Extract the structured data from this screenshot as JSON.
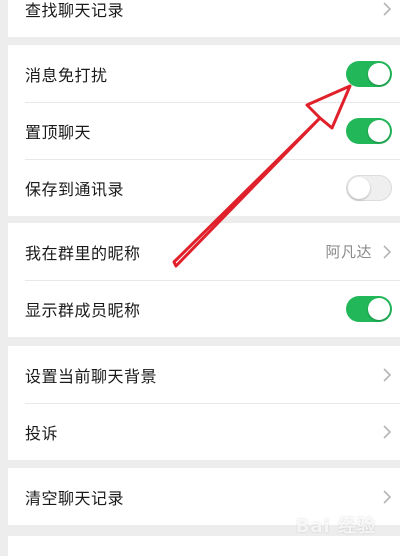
{
  "settings": {
    "search_history": {
      "label": "查找聊天记录"
    },
    "mute": {
      "label": "消息免打扰",
      "enabled": true
    },
    "sticky_on_top": {
      "label": "置顶聊天",
      "enabled": true
    },
    "save_to_contacts": {
      "label": "保存到通讯录",
      "enabled": false
    },
    "my_alias": {
      "label": "我在群里的昵称",
      "value": "阿凡达"
    },
    "show_member_names": {
      "label": "显示群成员昵称",
      "enabled": true
    },
    "chat_background": {
      "label": "设置当前聊天背景"
    },
    "complain": {
      "label": "投诉"
    },
    "clear_history": {
      "label": "清空聊天记录"
    }
  },
  "colors": {
    "toggle_on": "#22b85a",
    "toggle_off": "#efefef",
    "annotation_arrow": "#e0202a"
  },
  "watermark": {
    "text": "Bai 经验"
  }
}
